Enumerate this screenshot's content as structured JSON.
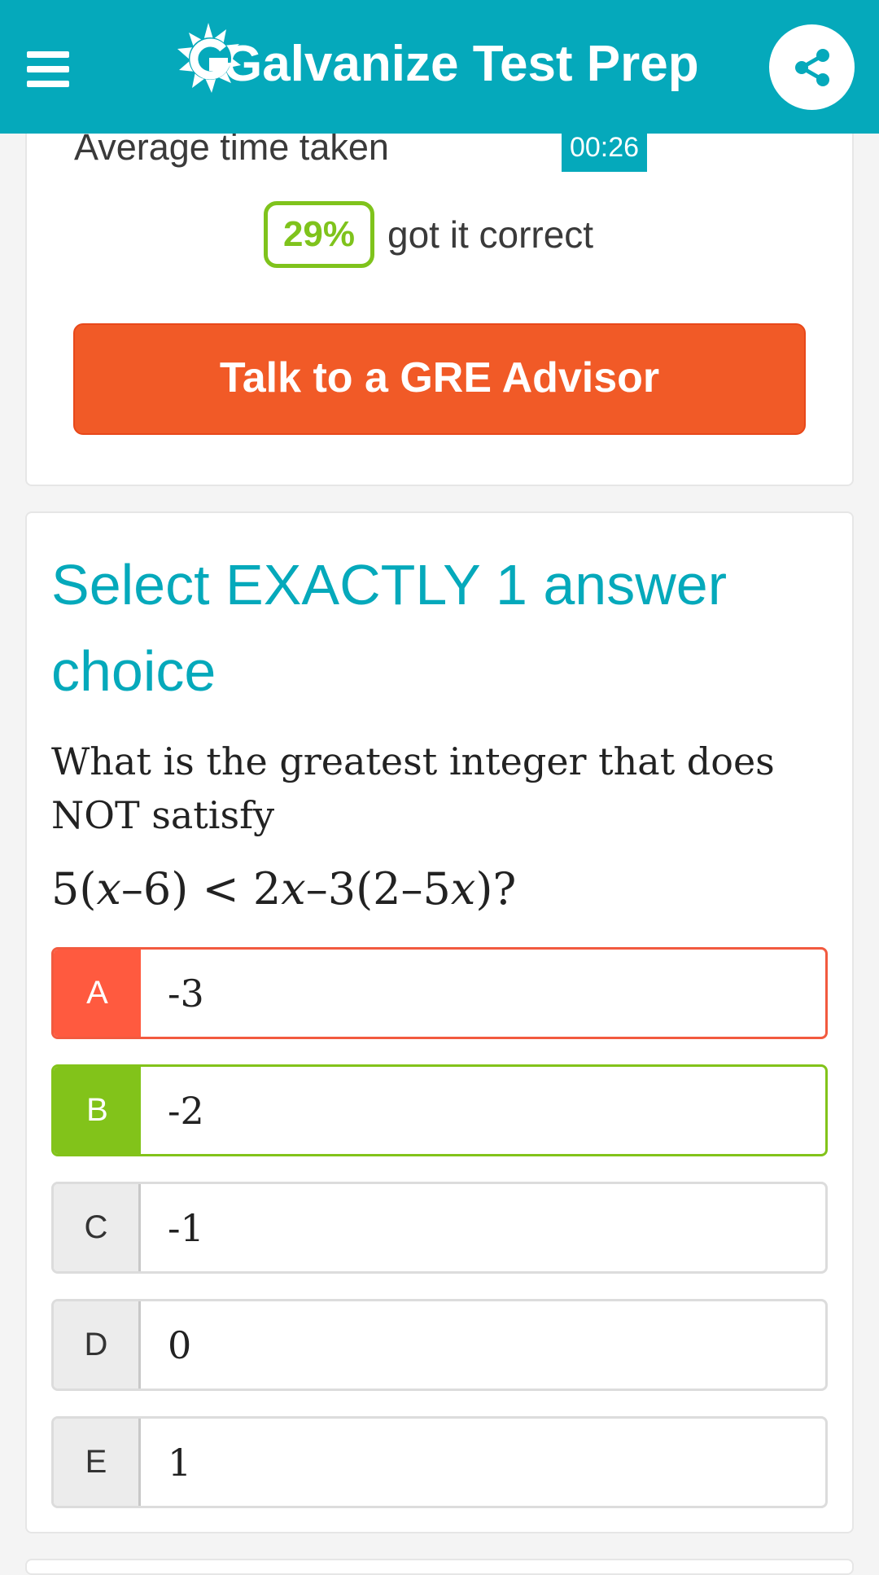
{
  "header": {
    "brand": "Galvanize Test Prep",
    "menu_icon": "hamburger-menu-icon",
    "share_icon": "share-icon",
    "colors": {
      "bar": "#05a9bb"
    }
  },
  "stats": {
    "avg_label": "Average time taken",
    "avg_time": "00:26",
    "percent_correct": "29%",
    "correct_text": "got it correct"
  },
  "advisor_button": "Talk to a GRE Advisor",
  "question": {
    "instruction": "Select EXACTLY 1 answer choice",
    "prompt": "What is the greatest integer that does NOT satisfy"
  },
  "choices": [
    {
      "letter": "A",
      "value": "-3",
      "state": "wrong"
    },
    {
      "letter": "B",
      "value": "-2",
      "state": "correct"
    },
    {
      "letter": "C",
      "value": "-1",
      "state": "none"
    },
    {
      "letter": "D",
      "value": "0",
      "state": "none"
    },
    {
      "letter": "E",
      "value": "1",
      "state": "none"
    }
  ],
  "colors": {
    "accent": "#05a9bb",
    "advisor": "#f15a27",
    "wrong": "#ff5a3f",
    "correct": "#82c31a"
  }
}
